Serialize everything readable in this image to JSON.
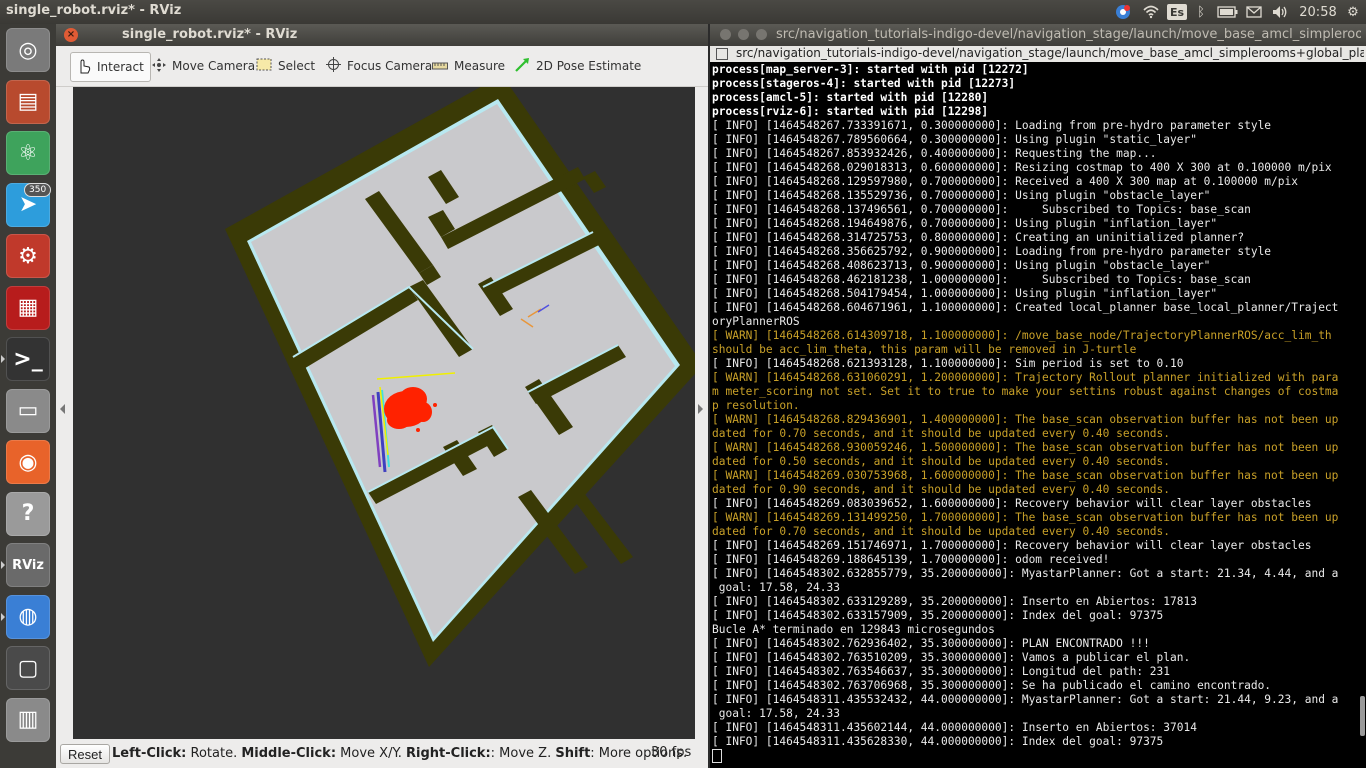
{
  "top_panel": {
    "title": "single_robot.rviz* - RViz",
    "keyboard_layout": "Es",
    "clock": "20:58"
  },
  "launcher": {
    "items": [
      {
        "name": "ubuntu-dash-icon",
        "glyph": "◎",
        "color": "#7a7a7a"
      },
      {
        "name": "files-icon",
        "glyph": "▤",
        "color": "#b84a2e"
      },
      {
        "name": "atom-icon",
        "glyph": "⚛",
        "color": "#3ea35c"
      },
      {
        "name": "telegram-icon",
        "glyph": "➤",
        "color": "#2d9ddc",
        "badge": "350"
      },
      {
        "name": "system-settings-icon",
        "glyph": "⚙",
        "color": "#c0392b"
      },
      {
        "name": "workspace-switcher-icon",
        "glyph": "▦",
        "color": "#b71c1c"
      },
      {
        "name": "terminal-icon",
        "glyph": ">_",
        "color": "#333333"
      },
      {
        "name": "scanner-icon",
        "glyph": "▭",
        "color": "#8a8a8a"
      },
      {
        "name": "firefox-icon",
        "glyph": "◉",
        "color": "#e8632a"
      },
      {
        "name": "help-icon",
        "glyph": "?",
        "color": "#9a9a9a"
      },
      {
        "name": "rviz-icon",
        "glyph": "RViz",
        "color": "#6a6a6a"
      },
      {
        "name": "chromium-icon",
        "glyph": "◍",
        "color": "#3a7fd5"
      },
      {
        "name": "show-desktop-icon",
        "glyph": "▢",
        "color": "#4a4a4a"
      },
      {
        "name": "trash-icon",
        "glyph": "▥",
        "color": "#8a8a8a"
      }
    ]
  },
  "rviz": {
    "title": "single_robot.rviz* - RViz",
    "tools": [
      {
        "label": "Interact",
        "icon": "hand-pointer-icon",
        "active": true
      },
      {
        "label": "Move Camera",
        "icon": "move-camera-icon",
        "active": false
      },
      {
        "label": "Select",
        "icon": "select-box-icon",
        "active": false
      },
      {
        "label": "Focus Camera",
        "icon": "focus-camera-icon",
        "active": false
      },
      {
        "label": "Measure",
        "icon": "ruler-icon",
        "active": false
      },
      {
        "label": "2D Pose Estimate",
        "icon": "pose-arrow-icon",
        "active": false
      }
    ],
    "status": {
      "reset_label": "Reset",
      "hint_parts": [
        {
          "text": "Left-Click:",
          "bold": true
        },
        {
          "text": " Rotate. ",
          "bold": false
        },
        {
          "text": "Middle-Click:",
          "bold": true
        },
        {
          "text": " Move X/Y. ",
          "bold": false
        },
        {
          "text": "Right-Click:",
          "bold": true
        },
        {
          "text": ": Move Z. ",
          "bold": false
        },
        {
          "text": "Shift",
          "bold": true
        },
        {
          "text": ": More options.",
          "bold": false
        }
      ],
      "fps": "30 fps"
    },
    "colors": {
      "map_border": "#3a3a06",
      "floor": "#c8c8c8",
      "wall": "#3a3a06",
      "inflation": "#b8e8f0",
      "particles": "#ff2200"
    }
  },
  "terminal": {
    "title": "src/navigation_tutorials-indigo-devel/navigation_stage/launch/move_base_amcl_simplerooms+global_planner",
    "tab_title": "src/navigation_tutorials-indigo-devel/navigation_stage/launch/move_base_amcl_simplerooms+global_planner",
    "lines": [
      {
        "text": "process[map_server-3]: started with pid [12272]",
        "style": "bold"
      },
      {
        "text": "process[stageros-4]: started with pid [12273]",
        "style": "bold"
      },
      {
        "text": "process[amcl-5]: started with pid [12280]",
        "style": "bold"
      },
      {
        "text": "process[rviz-6]: started with pid [12298]",
        "style": "bold"
      },
      {
        "text": "[ INFO] [1464548267.733391671, 0.300000000]: Loading from pre-hydro parameter style",
        "style": "info"
      },
      {
        "text": "[ INFO] [1464548267.789560664, 0.300000000]: Using plugin \"static_layer\"",
        "style": "info"
      },
      {
        "text": "[ INFO] [1464548267.853932426, 0.400000000]: Requesting the map...",
        "style": "info"
      },
      {
        "text": "[ INFO] [1464548268.029018313, 0.600000000]: Resizing costmap to 400 X 300 at 0.100000 m/pix",
        "style": "info"
      },
      {
        "text": "[ INFO] [1464548268.129597980, 0.700000000]: Received a 400 X 300 map at 0.100000 m/pix",
        "style": "info"
      },
      {
        "text": "[ INFO] [1464548268.135529736, 0.700000000]: Using plugin \"obstacle_layer\"",
        "style": "info"
      },
      {
        "text": "[ INFO] [1464548268.137496561, 0.700000000]:     Subscribed to Topics: base_scan",
        "style": "info"
      },
      {
        "text": "[ INFO] [1464548268.194649876, 0.700000000]: Using plugin \"inflation_layer\"",
        "style": "info"
      },
      {
        "text": "[ INFO] [1464548268.314725753, 0.800000000]: Creating an uninitialized planner?",
        "style": "info"
      },
      {
        "text": "[ INFO] [1464548268.356625792, 0.900000000]: Loading from pre-hydro parameter style",
        "style": "info"
      },
      {
        "text": "[ INFO] [1464548268.408623713, 0.900000000]: Using plugin \"obstacle_layer\"",
        "style": "info"
      },
      {
        "text": "[ INFO] [1464548268.462181238, 1.000000000]:     Subscribed to Topics: base_scan",
        "style": "info"
      },
      {
        "text": "[ INFO] [1464548268.504179454, 1.000000000]: Using plugin \"inflation_layer\"",
        "style": "info"
      },
      {
        "text": "[ INFO] [1464548268.604671961, 1.100000000]: Created local_planner base_local_planner/Traject",
        "style": "info"
      },
      {
        "text": "oryPlannerROS",
        "style": "info"
      },
      {
        "text": "[ WARN] [1464548268.614309718, 1.100000000]: /move_base_node/TrajectoryPlannerROS/acc_lim_th",
        "style": "warn"
      },
      {
        "text": "should be acc_lim_theta, this param will be removed in J-turtle",
        "style": "warn"
      },
      {
        "text": "[ INFO] [1464548268.621393128, 1.100000000]: Sim period is set to 0.10",
        "style": "info"
      },
      {
        "text": "[ WARN] [1464548268.631060291, 1.200000000]: Trajectory Rollout planner initialized with para",
        "style": "warn"
      },
      {
        "text": "m meter_scoring not set. Set it to true to make your settins robust against changes of costma",
        "style": "warn"
      },
      {
        "text": "p resolution.",
        "style": "warn"
      },
      {
        "text": "[ WARN] [1464548268.829436901, 1.400000000]: The base_scan observation buffer has not been up",
        "style": "warn"
      },
      {
        "text": "dated for 0.70 seconds, and it should be updated every 0.40 seconds.",
        "style": "warn"
      },
      {
        "text": "[ WARN] [1464548268.930059246, 1.500000000]: The base_scan observation buffer has not been up",
        "style": "warn"
      },
      {
        "text": "dated for 0.50 seconds, and it should be updated every 0.40 seconds.",
        "style": "warn"
      },
      {
        "text": "[ WARN] [1464548269.030753968, 1.600000000]: The base_scan observation buffer has not been up",
        "style": "warn"
      },
      {
        "text": "dated for 0.90 seconds, and it should be updated every 0.40 seconds.",
        "style": "warn"
      },
      {
        "text": "[ INFO] [1464548269.083039652, 1.600000000]: Recovery behavior will clear layer obstacles",
        "style": "info"
      },
      {
        "text": "[ WARN] [1464548269.131499250, 1.700000000]: The base_scan observation buffer has not been up",
        "style": "warn"
      },
      {
        "text": "dated for 0.70 seconds, and it should be updated every 0.40 seconds.",
        "style": "warn"
      },
      {
        "text": "[ INFO] [1464548269.151746971, 1.700000000]: Recovery behavior will clear layer obstacles",
        "style": "info"
      },
      {
        "text": "[ INFO] [1464548269.188645139, 1.700000000]: odom received!",
        "style": "info"
      },
      {
        "text": "[ INFO] [1464548302.632855779, 35.200000000]: MyastarPlanner: Got a start: 21.34, 4.44, and a",
        "style": "info"
      },
      {
        "text": " goal: 17.58, 24.33",
        "style": "info"
      },
      {
        "text": "[ INFO] [1464548302.633129289, 35.200000000]: Inserto en Abiertos: 17813",
        "style": "info"
      },
      {
        "text": "[ INFO] [1464548302.633157909, 35.200000000]: Index del goal: 97375",
        "style": "info"
      },
      {
        "text": "Bucle A* terminado en 129843 microsegundos",
        "style": "info"
      },
      {
        "text": "[ INFO] [1464548302.762936402, 35.300000000]: PLAN ENCONTRADO !!!",
        "style": "info"
      },
      {
        "text": "[ INFO] [1464548302.763510209, 35.300000000]: Vamos a publicar el plan.",
        "style": "info"
      },
      {
        "text": "[ INFO] [1464548302.763546637, 35.300000000]: Longitud del path: 231",
        "style": "info"
      },
      {
        "text": "[ INFO] [1464548302.763706968, 35.300000000]: Se ha publicado el camino encontrado.",
        "style": "info"
      },
      {
        "text": "[ INFO] [1464548311.435532432, 44.000000000]: MyastarPlanner: Got a start: 21.44, 9.23, and a",
        "style": "info"
      },
      {
        "text": " goal: 17.58, 24.33",
        "style": "info"
      },
      {
        "text": "[ INFO] [1464548311.435602144, 44.000000000]: Inserto en Abiertos: 37014",
        "style": "info"
      },
      {
        "text": "[ INFO] [1464548311.435628330, 44.000000000]: Index del goal: 97375",
        "style": "info"
      }
    ]
  }
}
